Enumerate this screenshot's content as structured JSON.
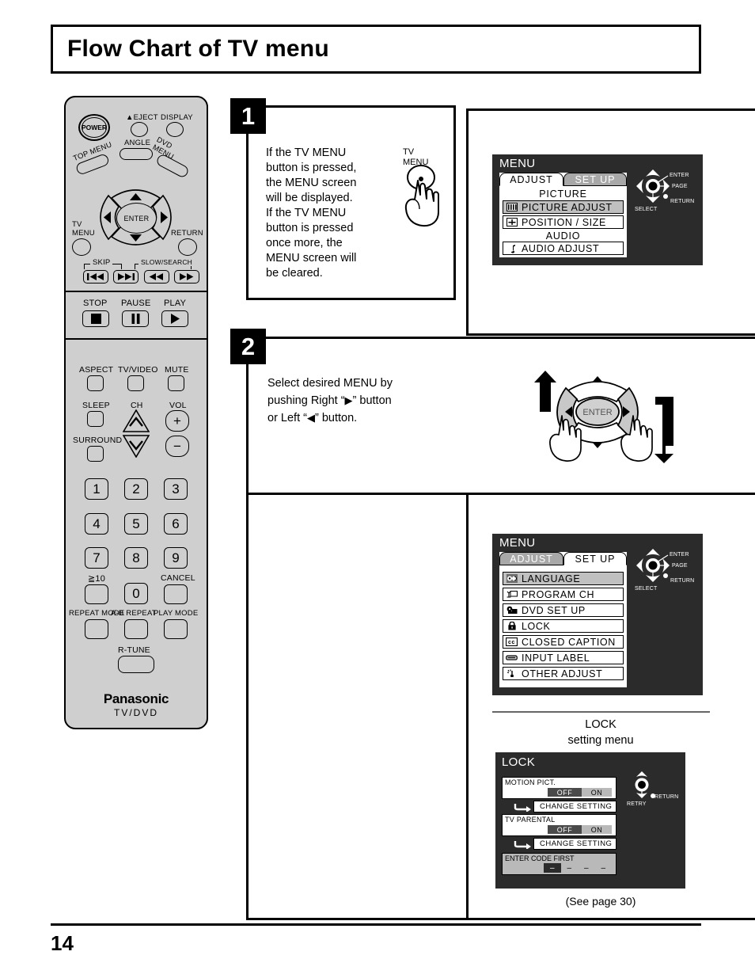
{
  "title": "Flow Chart of TV menu",
  "page_number": "14",
  "remote": {
    "power_label": "POWER",
    "eject_label": "EJECT",
    "display_label": "DISPLAY",
    "angle_label": "ANGLE",
    "top_menu_label": "TOP MENU",
    "dvd_menu_label": "DVD\nMENU",
    "enter_label": "ENTER",
    "tv_menu_label": "TV\nMENU",
    "return_label": "RETURN",
    "skip_label": "SKIP",
    "slow_search_label": "SLOW/SEARCH",
    "stop_label": "STOP",
    "pause_label": "PAUSE",
    "play_label": "PLAY",
    "aspect_label": "ASPECT",
    "tv_video_label": "TV/VIDEO",
    "mute_label": "MUTE",
    "sleep_label": "SLEEP",
    "ch_label": "CH",
    "vol_label": "VOL",
    "surround_label": "SURROUND",
    "numbers": [
      "1",
      "2",
      "3",
      "4",
      "5",
      "6",
      "7",
      "8",
      "9"
    ],
    "zero_label": "0",
    "gte10_label": "≧10",
    "cancel_label": "CANCEL",
    "repeat_mode_label": "REPEAT MODE",
    "ab_repeat_label": "A-B REPEAT",
    "play_mode_label": "PLAY MODE",
    "r_tune_label": "R-TUNE",
    "brand": "Panasonic",
    "brand_sub": "TV/DVD"
  },
  "steps": [
    {
      "number": "1",
      "text": "If the TV MENU\nbutton is pressed,\nthe MENU screen\nwill be displayed.\nIf the TV MENU\nbutton is pressed\nonce more, the\nMENU screen will\nbe cleared.",
      "hand_label": "TV\nMENU"
    },
    {
      "number": "2",
      "text_parts": {
        "line1": "Select desired MENU by",
        "line2_a": "pushing Right “",
        "line2_arrow": "▶",
        "line2_b": "” button",
        "line3_a": "or Left “",
        "line3_arrow": "◀",
        "line3_b": "” button."
      }
    }
  ],
  "osd_adjust": {
    "title": "MENU",
    "tabs": [
      {
        "label": "ADJUST",
        "active": true
      },
      {
        "label": "SET UP",
        "active": false
      }
    ],
    "groups": [
      {
        "heading": "PICTURE",
        "items": [
          {
            "label": "PICTURE  ADJUST",
            "icon": "picture-bars-icon",
            "highlighted": true
          },
          {
            "label": "POSITION / SIZE",
            "icon": "position-size-icon",
            "highlighted": false
          }
        ]
      },
      {
        "heading": "AUDIO",
        "items": [
          {
            "label": "AUDIO  ADJUST",
            "icon": "music-note-icon",
            "highlighted": false
          }
        ]
      }
    ],
    "nav": {
      "enter": "ENTER",
      "page": "PAGE",
      "return": "RETURN",
      "select": "SELECT"
    }
  },
  "osd_setup": {
    "title": "MENU",
    "tabs": [
      {
        "label": "ADJUST",
        "active": false
      },
      {
        "label": "SET UP",
        "active": true
      }
    ],
    "items": [
      {
        "label": "LANGUAGE",
        "icon": "language-icon",
        "highlighted": true
      },
      {
        "label": "PROGRAM  CH",
        "icon": "antenna-icon",
        "highlighted": false
      },
      {
        "label": "DVD  SET  UP",
        "icon": "disc-icon",
        "highlighted": false
      },
      {
        "label": "LOCK",
        "icon": "padlock-icon",
        "highlighted": false
      },
      {
        "label": "CLOSED CAPTION",
        "icon": "closed-caption-icon",
        "highlighted": false
      },
      {
        "label": "INPUT  LABEL",
        "icon": "input-label-icon",
        "highlighted": false
      },
      {
        "label": "OTHER  ADJUST",
        "icon": "other-adjust-icon",
        "highlighted": false
      }
    ],
    "nav": {
      "enter": "ENTER",
      "page": "PAGE",
      "return": "RETURN",
      "select": "SELECT"
    }
  },
  "lock_caption": "LOCK\nsetting menu",
  "osd_lock": {
    "title": "LOCK",
    "rows": [
      {
        "label": "MOTION  PICT.",
        "off": "OFF",
        "on": "ON",
        "selected": "OFF",
        "change": "CHANGE  SETTING"
      },
      {
        "label": "TV  PARENTAL",
        "off": "OFF",
        "on": "ON",
        "selected": "OFF",
        "change": "CHANGE  SETTING"
      }
    ],
    "code_label": "ENTER CODE FIRST",
    "code_digits": [
      "–",
      "–",
      "–",
      "–"
    ],
    "nav": {
      "retry": "RETRY",
      "return": "RETURN"
    }
  },
  "see_page": "(See page 30)"
}
